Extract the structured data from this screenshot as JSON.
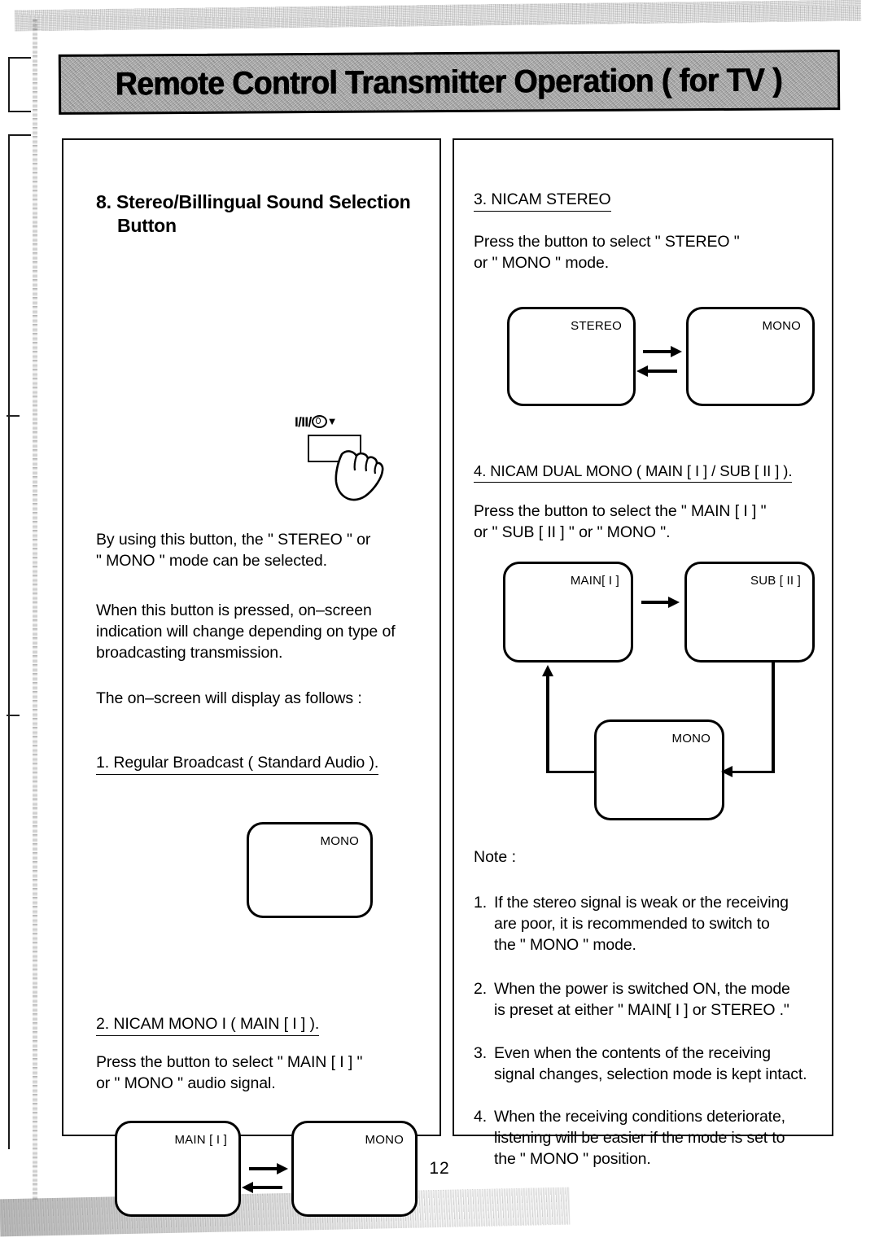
{
  "banner": {
    "title": "Remote Control Transmitter Operation ( for TV )"
  },
  "page": {
    "number": "12"
  },
  "left_column": {
    "heading_line1": "8. Stereo/Billingual Sound Selection",
    "heading_line2": "Button",
    "button_illustration": {
      "label_prefix": "I/II/",
      "label_triangle": "▼",
      "icon_name": "stereo-bilingual-button"
    },
    "paragraphs": [
      "By using this button, the \" STEREO \" or\n\" MONO \" mode can be selected.",
      "When this button is pressed, on–screen\nindication will change depending on type of\nbroadcasting transmission.",
      "The on–screen will display as follows :"
    ],
    "section1": {
      "heading": "1. Regular Broadcast ( Standard Audio ).",
      "screens": [
        {
          "label": "MONO"
        }
      ]
    },
    "section2": {
      "heading": "2. NICAM MONO I ( MAIN [ I ] ).",
      "body": "Press the button to select \" MAIN [ I ]     \"\nor \" MONO \" audio signal.",
      "screens": [
        {
          "label": "MAIN [ I ]"
        },
        {
          "label": "MONO"
        }
      ]
    }
  },
  "right_column": {
    "section3": {
      "heading": "3. NICAM STEREO",
      "body": "Press the button to select \" STEREO \"\nor \" MONO \" mode.",
      "screens": [
        {
          "label": "STEREO"
        },
        {
          "label": "MONO"
        }
      ]
    },
    "section4": {
      "heading": "4. NICAM DUAL MONO ( MAIN [ I ] / SUB [ II ] ).",
      "body": "Press the button to select the \" MAIN [ I ] \"\nor \" SUB [ II ] \" or \" MONO \".",
      "screens": [
        {
          "label": "MAIN[ I ]"
        },
        {
          "label": "SUB [ II ]"
        },
        {
          "label": "MONO"
        }
      ]
    },
    "note": {
      "title": "Note :",
      "items": [
        {
          "num": "1.",
          "text": "If the stereo signal is weak or the receiving\nare poor, it is recommended to switch to\nthe \" MONO \" mode."
        },
        {
          "num": "2.",
          "text": "When the power is switched ON, the mode\n is preset at either \" MAIN[ I ] or STEREO .\""
        },
        {
          "num": "3.",
          "text": "Even when the contents of the receiving\nsignal changes, selection mode is kept intact."
        },
        {
          "num": "4.",
          "text": "When the receiving conditions deteriorate,\nlistening will be easier if the mode is set to\nthe \" MONO \" position."
        }
      ]
    }
  }
}
